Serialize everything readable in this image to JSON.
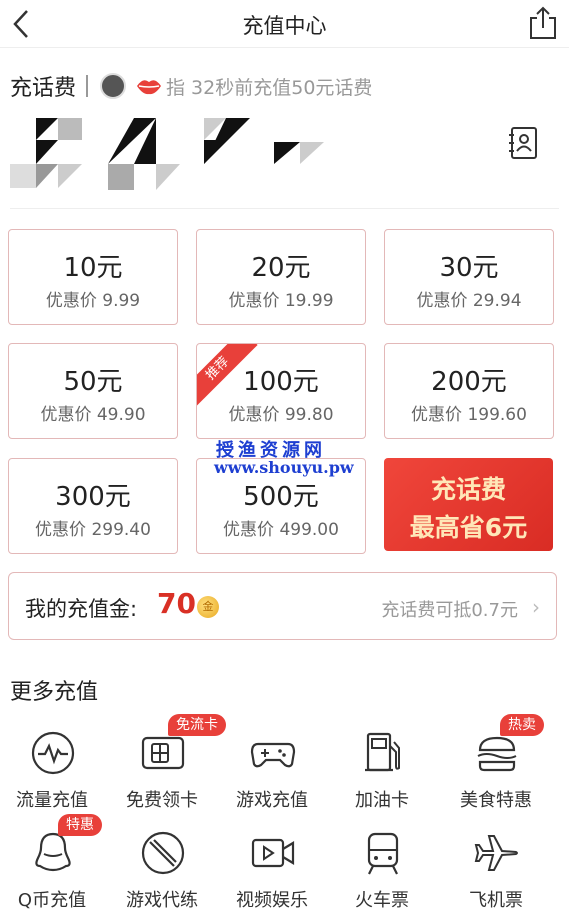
{
  "header": {
    "title": "充值中心",
    "back_icon": "back-arrow-icon",
    "share_icon": "share-icon"
  },
  "recharge": {
    "label": "充话费",
    "marquee": "指  32秒前充值50元话费"
  },
  "plans": [
    {
      "amount": "10元",
      "price": "优惠价 9.99"
    },
    {
      "amount": "20元",
      "price": "优惠价 19.99"
    },
    {
      "amount": "30元",
      "price": "优惠价 29.94"
    },
    {
      "amount": "50元",
      "price": "优惠价 49.90"
    },
    {
      "amount": "100元",
      "price": "优惠价 99.80",
      "tag": "推荐"
    },
    {
      "amount": "200元",
      "price": "优惠价 199.60"
    },
    {
      "amount": "300元",
      "price": "优惠价 299.40"
    },
    {
      "amount": "500元",
      "price": "优惠价 499.00"
    }
  ],
  "promo": {
    "line1": "充话费",
    "line2": "最高省6元"
  },
  "watermark": {
    "line1": "授渔资源网",
    "line2": "www.shouyu.pw"
  },
  "wallet": {
    "label": "我的充值金:",
    "amount": "70",
    "coin": "金",
    "hint": "充话费可抵0.7元",
    "chevron": "›"
  },
  "more": {
    "title": "更多充值"
  },
  "services": [
    {
      "label": "流量充值",
      "icon": "pulse-icon"
    },
    {
      "label": "免费领卡",
      "icon": "sim-card-icon",
      "badge": "免流卡"
    },
    {
      "label": "游戏充值",
      "icon": "gamepad-icon"
    },
    {
      "label": "加油卡",
      "icon": "fuel-pump-icon"
    },
    {
      "label": "美食特惠",
      "icon": "burger-icon",
      "badge": "热卖"
    },
    {
      "label": "Q币充值",
      "icon": "penguin-icon",
      "badge": "特惠"
    },
    {
      "label": "游戏代练",
      "icon": "sword-icon"
    },
    {
      "label": "视频娱乐",
      "icon": "video-icon"
    },
    {
      "label": "火车票",
      "icon": "train-icon"
    },
    {
      "label": "飞机票",
      "icon": "airplane-icon"
    }
  ],
  "colors": {
    "accent": "#e8403a",
    "card_border": "#e3b8b8",
    "watermark": "#1e3fd1"
  }
}
